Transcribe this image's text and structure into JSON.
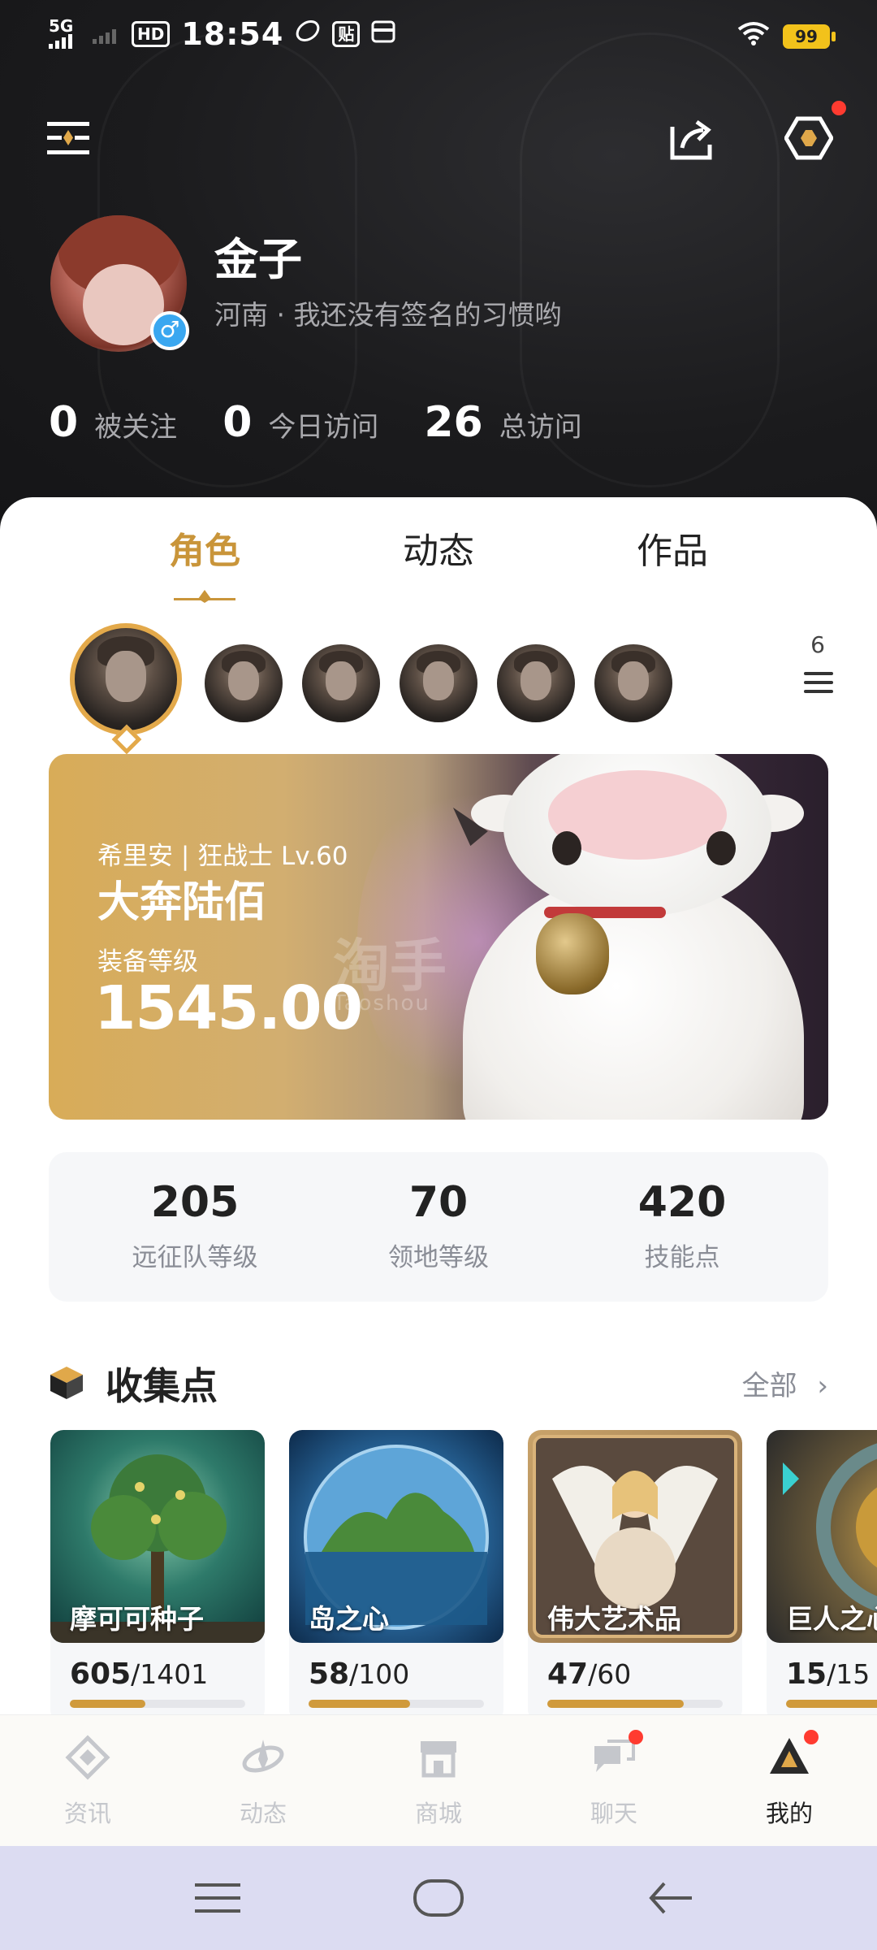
{
  "status_bar": {
    "network": "5G",
    "hd": "HD",
    "time": "18:54",
    "tie_label": "贴",
    "battery": "99"
  },
  "profile": {
    "name": "金子",
    "bio": "河南 · 我还没有签名的习惯哟",
    "gender_symbol": "♂"
  },
  "stats": [
    {
      "value": "0",
      "label": "被关注"
    },
    {
      "value": "0",
      "label": "今日访问"
    },
    {
      "value": "26",
      "label": "总访问"
    }
  ],
  "tabs": [
    {
      "label": "角色",
      "active": true
    },
    {
      "label": "动态",
      "active": false
    },
    {
      "label": "作品",
      "active": false
    }
  ],
  "roles": {
    "count": "6"
  },
  "character": {
    "meta": "希里安 | 狂战士 Lv.60",
    "name": "大奔陆佰",
    "gear_label": "装备等级",
    "gear_score": "1545.00",
    "watermark": "淘手",
    "watermark_sub": "Taoshou"
  },
  "levels": [
    {
      "value": "205",
      "label": "远征队等级"
    },
    {
      "value": "70",
      "label": "领地等级"
    },
    {
      "value": "420",
      "label": "技能点"
    }
  ],
  "collection": {
    "title": "收集点",
    "view_all": "全部",
    "items": [
      {
        "name": "摩可可种子",
        "current": "605",
        "total": "/1401",
        "progress": 0.43
      },
      {
        "name": "岛之心",
        "current": "58",
        "total": "/100",
        "progress": 0.58
      },
      {
        "name": "伟大艺术品",
        "current": "47",
        "total": "/60",
        "progress": 0.78
      },
      {
        "name": "巨人之心",
        "current": "15",
        "total": "/15",
        "progress": 1.0
      }
    ]
  },
  "bottom_nav": [
    {
      "label": "资讯",
      "active": false
    },
    {
      "label": "动态",
      "active": false
    },
    {
      "label": "商城",
      "active": false
    },
    {
      "label": "聊天",
      "active": false
    },
    {
      "label": "我的",
      "active": true
    }
  ],
  "colors": {
    "accent": "#c9953a",
    "header_bg": "#1b1b1d",
    "badge": "#ff3b30"
  }
}
